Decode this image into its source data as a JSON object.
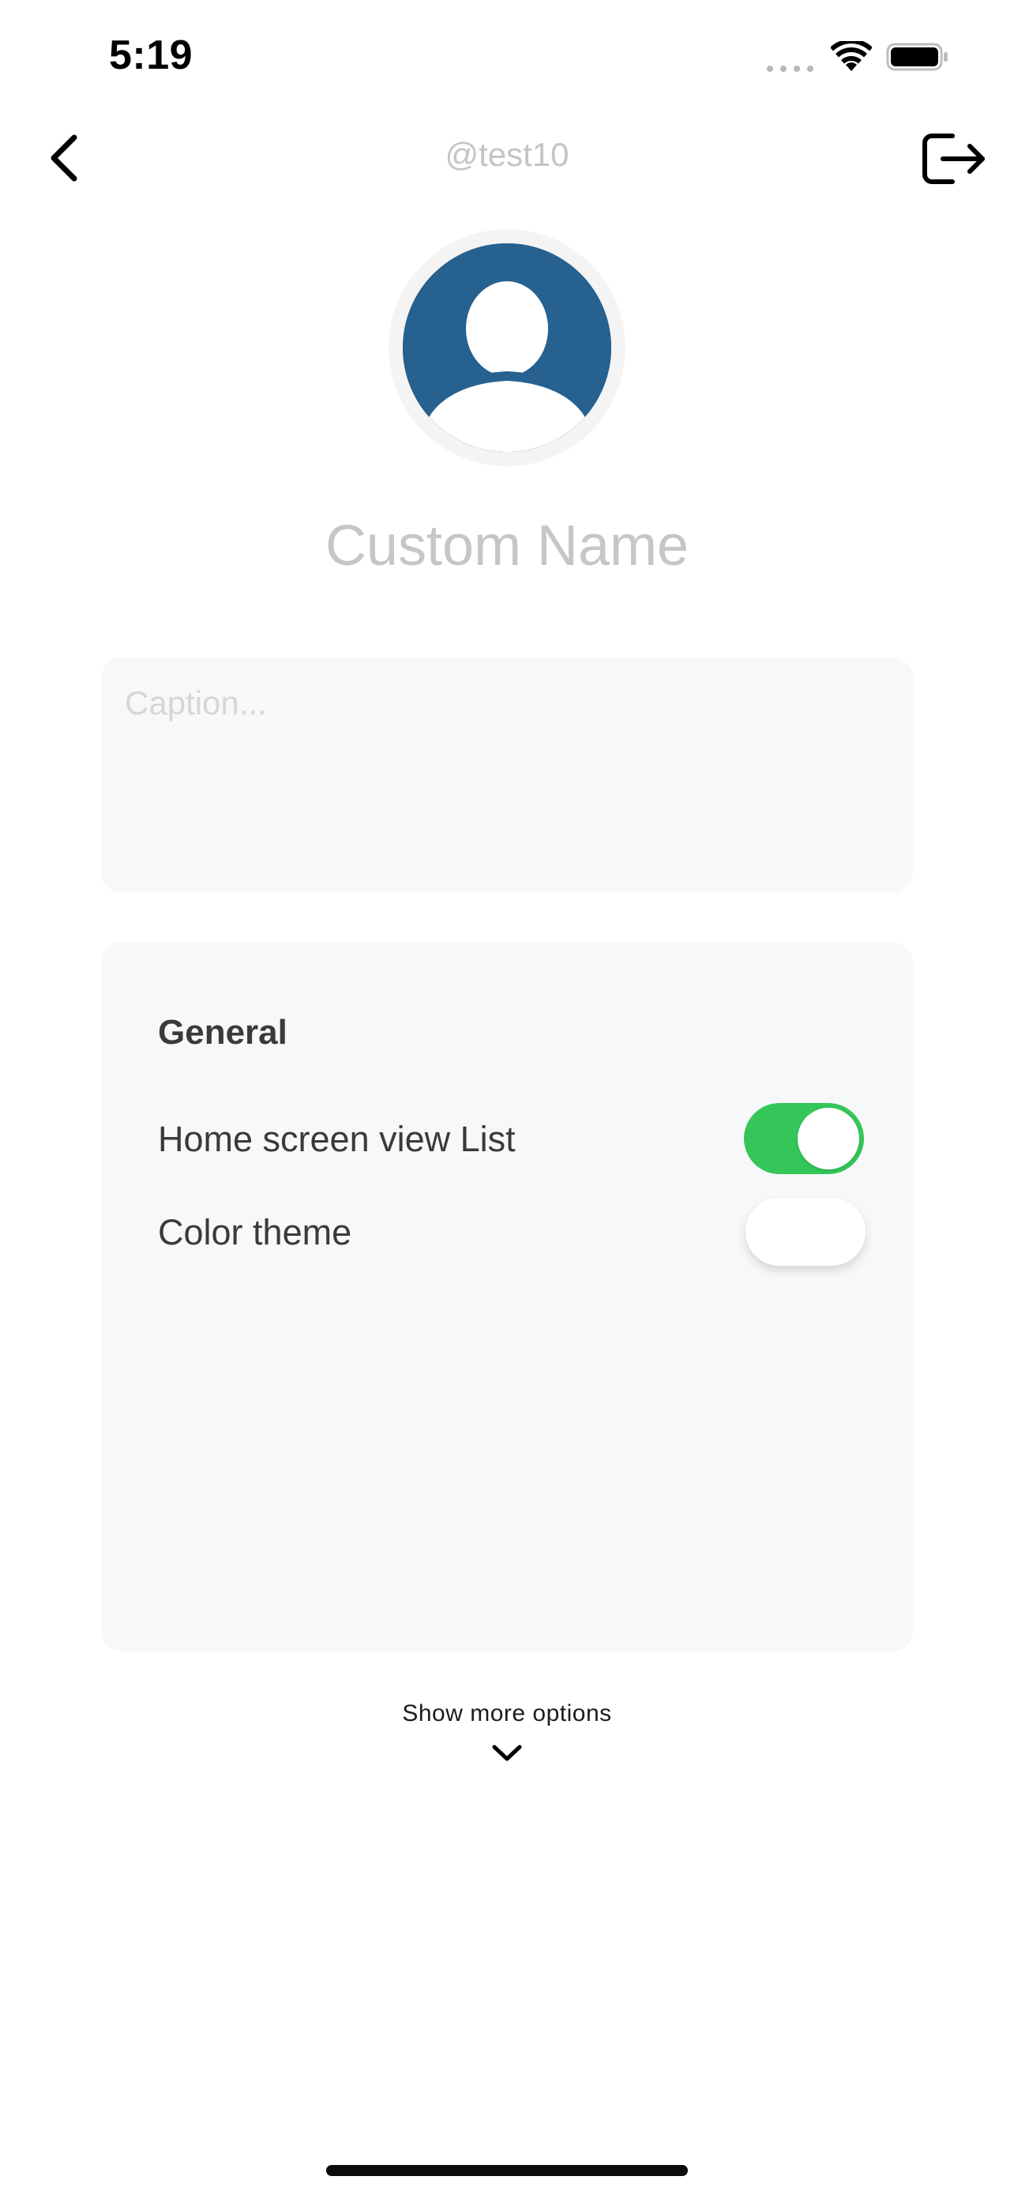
{
  "status_bar": {
    "time": "5:19"
  },
  "nav": {
    "handle": "@test10",
    "back_icon": "chevron-left-icon",
    "logout_icon": "logout-icon"
  },
  "profile": {
    "name_placeholder": "Custom Name",
    "avatar_color": "#26618f"
  },
  "caption": {
    "placeholder": "Caption...",
    "value": ""
  },
  "settings": {
    "section_title": "General",
    "rows": [
      {
        "label": "Home screen view List",
        "enabled": true
      },
      {
        "label": "Color theme",
        "enabled": false
      }
    ],
    "toggle_on_color": "#34c659"
  },
  "show_more": {
    "label": "Show more options",
    "icon": "chevron-down-icon"
  }
}
